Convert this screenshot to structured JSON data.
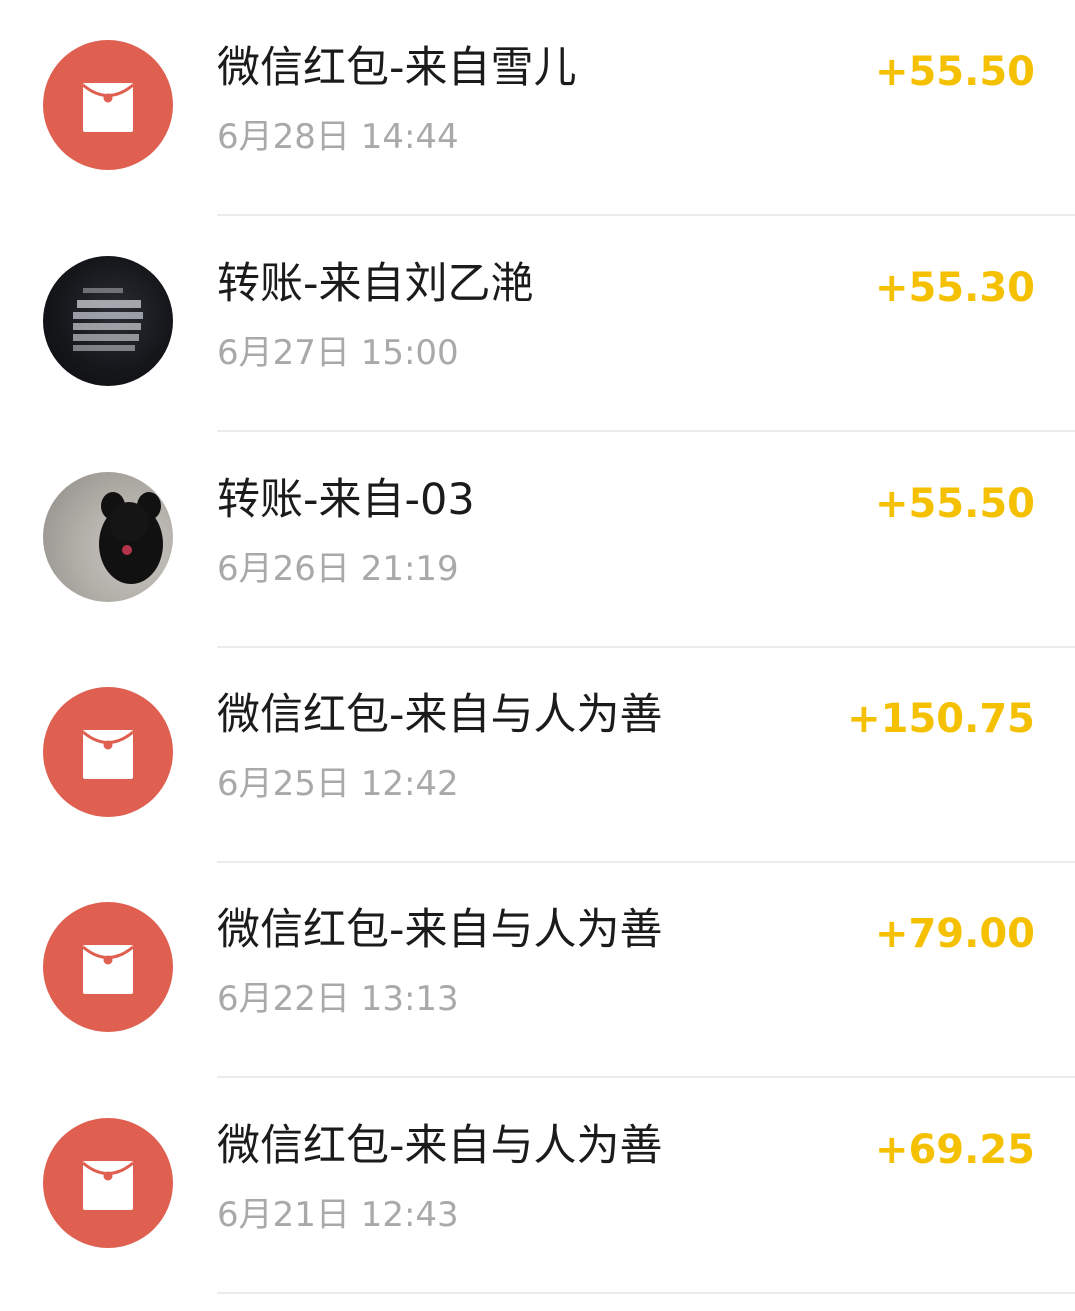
{
  "transactions": [
    {
      "title": "微信红包-来自雪儿",
      "time": "6月28日 14:44",
      "amount": "+55.50",
      "avatar": "red-packet-icon"
    },
    {
      "title": "转账-来自刘乙滟",
      "time": "6月27日 15:00",
      "amount": "+55.30",
      "avatar": "user-avatar-photo"
    },
    {
      "title": "转账-来自-03",
      "time": "6月26日 21:19",
      "amount": "+55.50",
      "avatar": "user-avatar-photo"
    },
    {
      "title": "微信红包-来自与人为善",
      "time": "6月25日 12:42",
      "amount": "+150.75",
      "avatar": "red-packet-icon"
    },
    {
      "title": "微信红包-来自与人为善",
      "time": "6月22日 13:13",
      "amount": "+79.00",
      "avatar": "red-packet-icon"
    },
    {
      "title": "微信红包-来自与人为善",
      "time": "6月21日 12:43",
      "amount": "+69.25",
      "avatar": "red-packet-icon"
    }
  ],
  "colors": {
    "amount": "#f5c000",
    "red_packet": "#df5f51",
    "title": "#1b1b1b",
    "time": "#a9a9a9",
    "divider": "#ececec"
  }
}
